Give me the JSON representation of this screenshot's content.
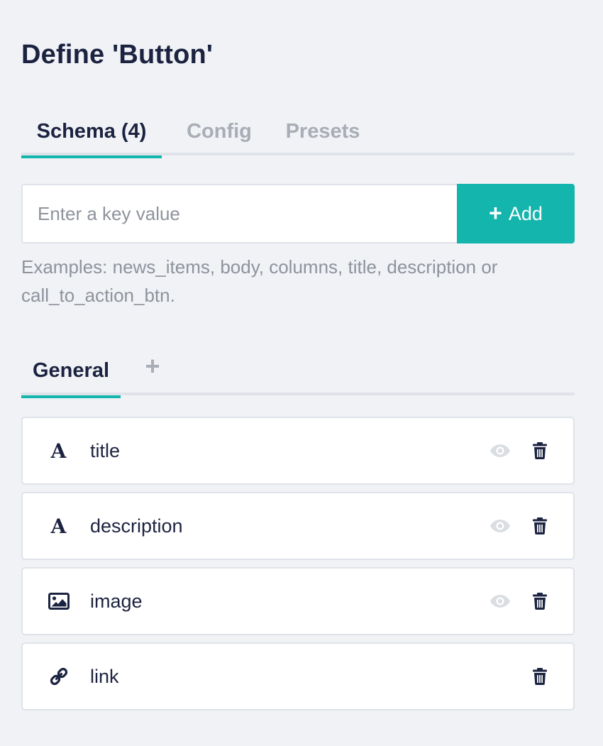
{
  "page_title": "Define 'Button'",
  "tabs": [
    {
      "label": "Schema (4)",
      "active": true
    },
    {
      "label": "Config",
      "active": false
    },
    {
      "label": "Presets",
      "active": false
    }
  ],
  "key_input": {
    "placeholder": "Enter a key value",
    "value": ""
  },
  "add_button": {
    "icon": "plus-icon",
    "label": "Add"
  },
  "hint": "Examples: news_items, body, columns, title, description or call_to_action_btn.",
  "group_tabs": [
    {
      "label": "General",
      "active": true
    }
  ],
  "group_add_label": "+",
  "fields": [
    {
      "name": "title",
      "icon": "text-icon",
      "icon_glyph": "A",
      "visibility_toggle": true
    },
    {
      "name": "description",
      "icon": "text-icon",
      "icon_glyph": "A",
      "visibility_toggle": true
    },
    {
      "name": "image",
      "icon": "image-icon",
      "visibility_toggle": true
    },
    {
      "name": "link",
      "icon": "link-icon",
      "visibility_toggle": false
    }
  ],
  "colors": {
    "accent": "#14b5ad",
    "text": "#1c2340",
    "muted": "#a9adb6",
    "border": "#dfe2e8",
    "background": "#f0f2f6",
    "eye": "#dadde2"
  }
}
